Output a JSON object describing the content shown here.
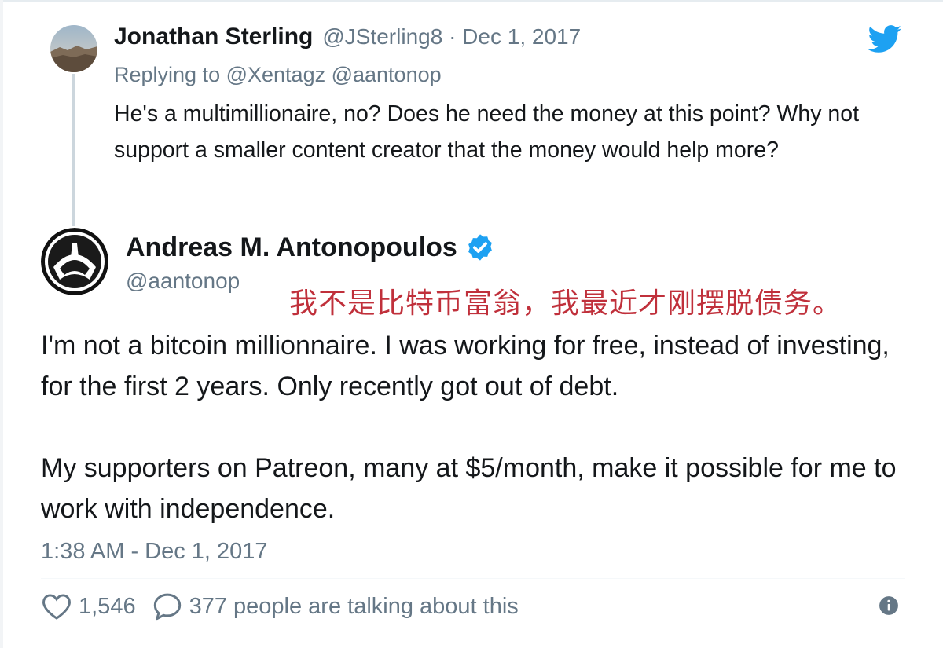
{
  "parent_tweet": {
    "name": "Jonathan Sterling",
    "handle": "@JSterling8",
    "separator": "·",
    "date": "Dec 1, 2017",
    "meta": "@JSterling8 · Dec 1, 2017",
    "replying_label": "Replying to",
    "replying_mentions": "@Xentagz @aantonop",
    "text": "He's a multimillionaire, no? Does he need the money at this point? Why not support a smaller content creator that the money would help more?"
  },
  "main_tweet": {
    "name": "Andreas M. Antonopoulos",
    "handle": "@aantonop",
    "annotation_zh": "我不是比特币富翁，我最近才刚摆脱债务。",
    "paragraph_1": "I'm not a bitcoin millionnaire. I was working for free, instead of investing, for the first 2 years. Only recently got out of debt.",
    "paragraph_2": "My supporters on Patreon, many at $5/month, make it possible for me to work with independence.",
    "timestamp": "1:38 AM - Dec 1, 2017",
    "likes": "1,546",
    "talking": "377 people are talking about this"
  },
  "icons": {
    "brand": "twitter-bird-icon",
    "verified": "verified-badge-icon",
    "like": "heart-icon",
    "reply": "speech-bubble-icon",
    "info": "info-icon"
  },
  "colors": {
    "twitter_blue": "#1da1f2",
    "secondary_text": "#657786",
    "primary_text": "#14171a",
    "annotation": "#c0303b",
    "thread_line": "#ccd6dd"
  }
}
